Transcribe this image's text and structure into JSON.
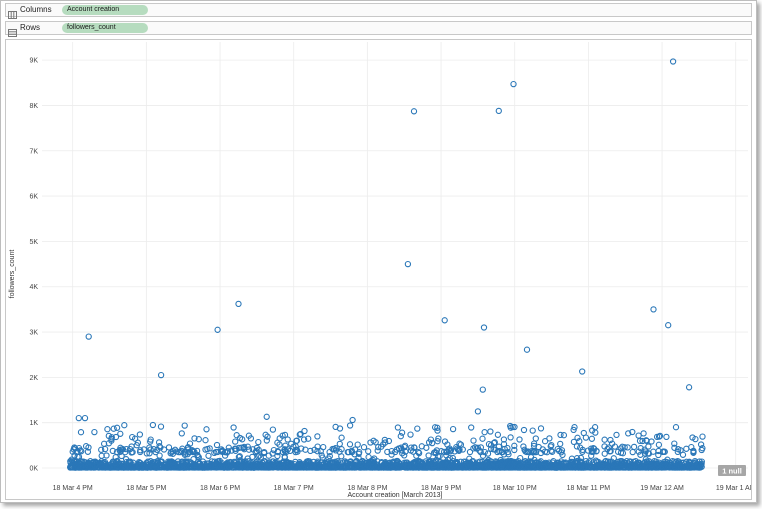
{
  "shelves": {
    "columns": {
      "label": "Columns",
      "field": "Account creation"
    },
    "rows": {
      "label": "Rows",
      "field": "followers_count"
    }
  },
  "icons": {
    "columns": "columns-shelf-icon",
    "rows": "rows-shelf-icon"
  },
  "null_badge": "1 null",
  "colors": {
    "mark": "#2a77b8",
    "grid": "#ececec",
    "badge": "#a6a6a6"
  },
  "chart_data": {
    "type": "scatter",
    "xlabel": "Account creation [March 2013]",
    "ylabel": "followers_count",
    "x_ticks": [
      "18 Mar 4 PM",
      "18 Mar 5 PM",
      "18 Mar 6 PM",
      "18 Mar 7 PM",
      "18 Mar 8 PM",
      "18 Mar 9 PM",
      "18 Mar 10 PM",
      "18 Mar 11 PM",
      "19 Mar 12 AM",
      "19 Mar 1 AM"
    ],
    "y_ticks": [
      "0K",
      "1K",
      "2K",
      "3K",
      "4K",
      "5K",
      "6K",
      "7K",
      "8K",
      "9K"
    ],
    "xlim": [
      "2013-03-18 15:35",
      "2013-03-19 01:10"
    ],
    "ylim": [
      0,
      9400
    ],
    "grid": true,
    "outliers": [
      {
        "x": "2013-03-18 16:13",
        "y": 2900
      },
      {
        "x": "2013-03-18 17:12",
        "y": 2050
      },
      {
        "x": "2013-03-18 17:58",
        "y": 3050
      },
      {
        "x": "2013-03-18 18:15",
        "y": 3620
      },
      {
        "x": "2013-03-18 18:38",
        "y": 1130
      },
      {
        "x": "2013-03-18 19:48",
        "y": 1060
      },
      {
        "x": "2013-03-18 20:33",
        "y": 4500
      },
      {
        "x": "2013-03-18 20:38",
        "y": 7870
      },
      {
        "x": "2013-03-18 21:03",
        "y": 3260
      },
      {
        "x": "2013-03-18 21:35",
        "y": 3100
      },
      {
        "x": "2013-03-18 21:47",
        "y": 7880
      },
      {
        "x": "2013-03-18 21:59",
        "y": 8470
      },
      {
        "x": "2013-03-18 22:10",
        "y": 2610
      },
      {
        "x": "2013-03-18 21:30",
        "y": 1250
      },
      {
        "x": "2013-03-18 21:34",
        "y": 1730
      },
      {
        "x": "2013-03-18 22:55",
        "y": 2130
      },
      {
        "x": "2013-03-18 23:53",
        "y": 3500
      },
      {
        "x": "2013-03-19 00:05",
        "y": 3150
      },
      {
        "x": "2013-03-19 00:09",
        "y": 8970
      },
      {
        "x": "2013-03-19 00:22",
        "y": 1780
      },
      {
        "x": "2013-03-18 16:10",
        "y": 1100
      },
      {
        "x": "2013-03-18 16:05",
        "y": 1100
      }
    ]
  }
}
